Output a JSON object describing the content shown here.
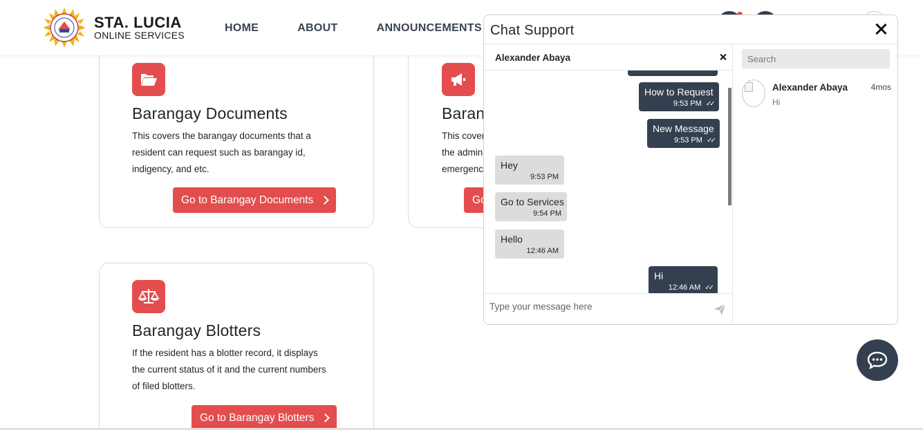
{
  "brand": {
    "title": "STA. LUCIA",
    "subtitle": "ONLINE SERVICES",
    "logo_icon": "barangay-seal-logo"
  },
  "nav": {
    "items": [
      {
        "label": "HOME"
      },
      {
        "label": "ABOUT"
      },
      {
        "label": "ANNOUNCEMENTS"
      }
    ]
  },
  "cards": [
    {
      "icon": "folder-open-icon",
      "title": "Barangay Documents",
      "desc_lines": [
        "This covers the barangay documents that a",
        "resident can request such as barangay id,",
        "indigency, and etc."
      ],
      "button": "Go to Barangay Documents"
    },
    {
      "icon": "megaphone-icon",
      "title": "Baran",
      "desc_lines": [
        "This cover",
        "the admin",
        "emergenc"
      ],
      "button": "Go"
    },
    {
      "icon": "scale-balance-icon",
      "title": "Barangay Blotters",
      "desc_lines": [
        "If the resident has a blotter record, it displays",
        "the current status of it and the current numbers",
        "of filed blotters."
      ],
      "button": "Go to Barangay Blotters"
    }
  ],
  "chat": {
    "title": "Chat Support",
    "conversation_name": "Alexander Abaya",
    "messages": [
      {
        "direction": "out",
        "text": "How to Request",
        "time": "9:53 PM"
      },
      {
        "direction": "out",
        "text": "New Message",
        "time": "9:53 PM"
      },
      {
        "direction": "in",
        "text": "Hey",
        "time": "9:53 PM"
      },
      {
        "direction": "in",
        "text": "Go to Services",
        "time": "9:54 PM"
      },
      {
        "direction": "in",
        "text": "Hello",
        "time": "12:46 AM"
      },
      {
        "direction": "out",
        "text": "Hi",
        "time": "12:46 AM"
      }
    ],
    "composer_placeholder": "Type your message here",
    "search_placeholder": "Search",
    "contacts": [
      {
        "name": "Alexander Abaya",
        "time": "4mos",
        "preview": "Hi"
      }
    ]
  },
  "colors": {
    "accent_red": "#e44d4d",
    "chat_dark": "#344050",
    "incoming_bubble": "#dcdcdc"
  }
}
